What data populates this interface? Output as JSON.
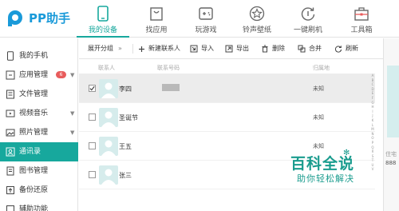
{
  "app": {
    "logo_text": "PP助手"
  },
  "topnav": [
    {
      "label": "我的设备",
      "icon": "phone-icon",
      "active": true
    },
    {
      "label": "找应用",
      "icon": "bag-icon",
      "active": false
    },
    {
      "label": "玩游戏",
      "icon": "gamepad-icon",
      "active": false
    },
    {
      "label": "铃声壁纸",
      "icon": "star-icon",
      "active": false
    },
    {
      "label": "一键刷机",
      "icon": "refresh-circle-icon",
      "active": false
    },
    {
      "label": "工具箱",
      "icon": "toolbox-icon",
      "active": false
    }
  ],
  "sidebar": {
    "items": [
      {
        "label": "我的手机",
        "icon": "phone-icon"
      },
      {
        "label": "应用管理",
        "icon": "apps-icon",
        "badge": "6"
      },
      {
        "label": "文件管理",
        "icon": "folder-icon"
      },
      {
        "label": "视频音乐",
        "icon": "video-icon"
      },
      {
        "label": "照片管理",
        "icon": "photo-icon"
      },
      {
        "label": "通讯录",
        "icon": "contacts-icon",
        "active": true
      },
      {
        "label": "图书管理",
        "icon": "book-icon"
      },
      {
        "label": "备份还原",
        "icon": "backup-icon"
      },
      {
        "label": "辅助功能",
        "icon": "tools-icon"
      }
    ]
  },
  "toolbar": {
    "expand_group": "展开分组",
    "expand_arrow": "»",
    "new_contact": "新建联系人",
    "import": "导入",
    "export": "导出",
    "delete": "删除",
    "merge": "合并",
    "refresh": "刷新"
  },
  "table": {
    "headers": {
      "name": "联系人",
      "number": "联系号码",
      "location": "归属地"
    },
    "rows": [
      {
        "name": "李四",
        "location": "未知",
        "checked": true,
        "selected": true
      },
      {
        "name": "圣诞节",
        "location": "未知",
        "checked": false,
        "selected": false
      },
      {
        "name": "王五",
        "location": "未知",
        "checked": false,
        "selected": false
      },
      {
        "name": "张三",
        "location": "",
        "checked": false,
        "selected": false
      }
    ]
  },
  "alpha_index": [
    "A",
    "B",
    "C",
    "D",
    "E",
    "F",
    "G",
    "H",
    "I",
    "J",
    "K",
    "L",
    "M",
    "N",
    "O",
    "P",
    "Q",
    "R",
    "S",
    "T",
    "U",
    "V"
  ],
  "right_panel": {
    "label": "住宅",
    "number": "888"
  },
  "watermark": {
    "main": "百科全说",
    "sub": "助你轻松解决"
  },
  "colors": {
    "accent": "#17a89d",
    "logo_blue": "#1a9ad9",
    "badge_red": "#e85c5c"
  }
}
